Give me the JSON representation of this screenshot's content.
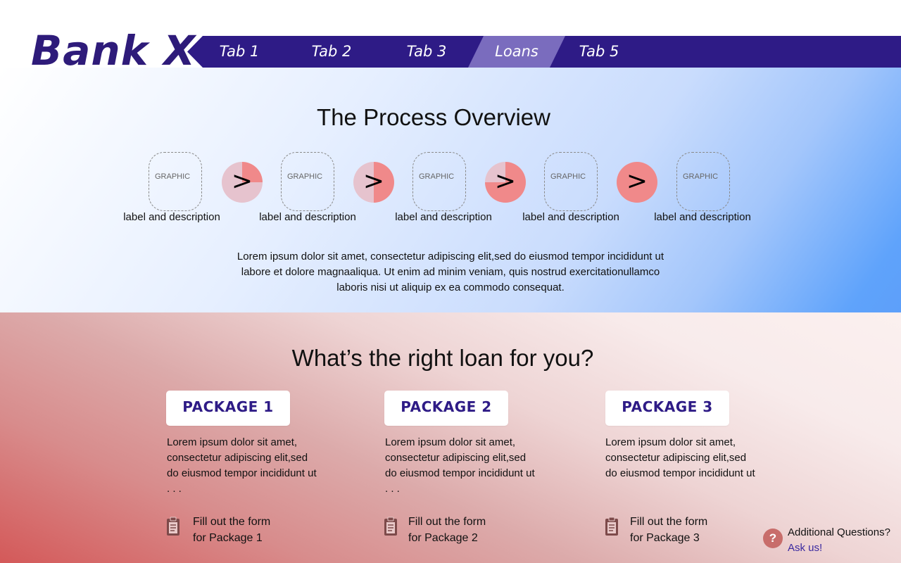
{
  "brand": {
    "name": "Bank X",
    "color": "#2e1b7a",
    "nav_color": "#2e1b86",
    "active_tab_color": "#7a6cbe"
  },
  "nav": {
    "tabs": [
      {
        "label": "Tab 1",
        "active": false
      },
      {
        "label": "Tab 2",
        "active": false
      },
      {
        "label": "Tab 3",
        "active": false
      },
      {
        "label": "Loans",
        "active": true
      },
      {
        "label": "Tab 5",
        "active": false
      }
    ]
  },
  "process": {
    "title": "The Process Overview",
    "steps": [
      {
        "graphic": "GRAPHIC",
        "label": "label and description"
      },
      {
        "graphic": "GRAPHIC",
        "label": "label and description"
      },
      {
        "graphic": "GRAPHIC",
        "label": "label and description"
      },
      {
        "graphic": "GRAPHIC",
        "label": "label and description"
      },
      {
        "graphic": "GRAPHIC",
        "label": "label and description"
      }
    ],
    "arrows": [
      {
        "symbol": ">",
        "progress": 0.25
      },
      {
        "symbol": ">",
        "progress": 0.5
      },
      {
        "symbol": ">",
        "progress": 0.75
      },
      {
        "symbol": ">",
        "progress": 1.0
      }
    ],
    "progress_color": "#f0898a",
    "progress_track_color": "#e6c3ce",
    "description": "Lorem ipsum dolor sit amet, consectetur adipiscing elit,sed do eiusmod tempor incididunt ut labore et dolore magnaaliqua. Ut enim ad minim veniam, quis nostrud exercitationullamco laboris nisi ut aliquip ex ea commodo consequat."
  },
  "loans": {
    "title": "What’s the right loan for you?",
    "packages": [
      {
        "name": "PACKAGE 1",
        "description": "Lorem ipsum dolor sit amet, consectetur adipiscing elit,sed do eiusmod tempor incididunt ut . . .",
        "form_line1": "Fill out the form",
        "form_line2": "for Package 1"
      },
      {
        "name": "PACKAGE 2",
        "description": "Lorem ipsum dolor sit amet, consectetur adipiscing elit,sed do eiusmod tempor incididunt ut . . .",
        "form_line1": "Fill out the form",
        "form_line2": "for Package 2"
      },
      {
        "name": "PACKAGE 3",
        "description": "Lorem ipsum dolor sit amet, consectetur adipiscing elit,sed do eiusmod tempor incididunt ut",
        "form_line1": "Fill out the form",
        "form_line2": "for Package 3"
      }
    ],
    "form_icon": "clipboard-icon",
    "icon_color": "#7d4a4a"
  },
  "help": {
    "icon": "?",
    "question": "Additional Questions?",
    "link": "Ask us!",
    "icon_color": "#c86d6b"
  }
}
